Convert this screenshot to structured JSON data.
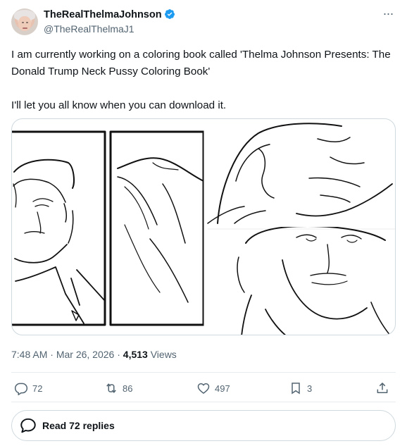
{
  "author": {
    "display_name": "TheRealThelmaJohnson",
    "handle": "@TheRealThelmaJ1",
    "verified": true
  },
  "tweet": {
    "text": "I am currently working on a coloring book called 'Thelma Johnson Presents: The Donald Trump Neck Pussy Coloring Book'\n\nI'll let you all know when you can download it.",
    "time": "7:48 AM",
    "separator": "·",
    "date": "Mar 26, 2026",
    "views_count": "4,513",
    "views_label": "Views"
  },
  "actions": {
    "replies": "72",
    "retweets": "86",
    "likes": "497",
    "bookmarks": "3"
  },
  "read_replies_label": "Read 72 replies",
  "colors": {
    "text": "#0f1419",
    "secondary": "#536471",
    "border": "#cfd9de",
    "verified_blue": "#1d9bf0"
  },
  "icons": [
    "more-icon",
    "verified-icon",
    "reply-icon",
    "retweet-icon",
    "like-icon",
    "bookmark-icon",
    "share-icon",
    "speech-bubble-icon"
  ]
}
